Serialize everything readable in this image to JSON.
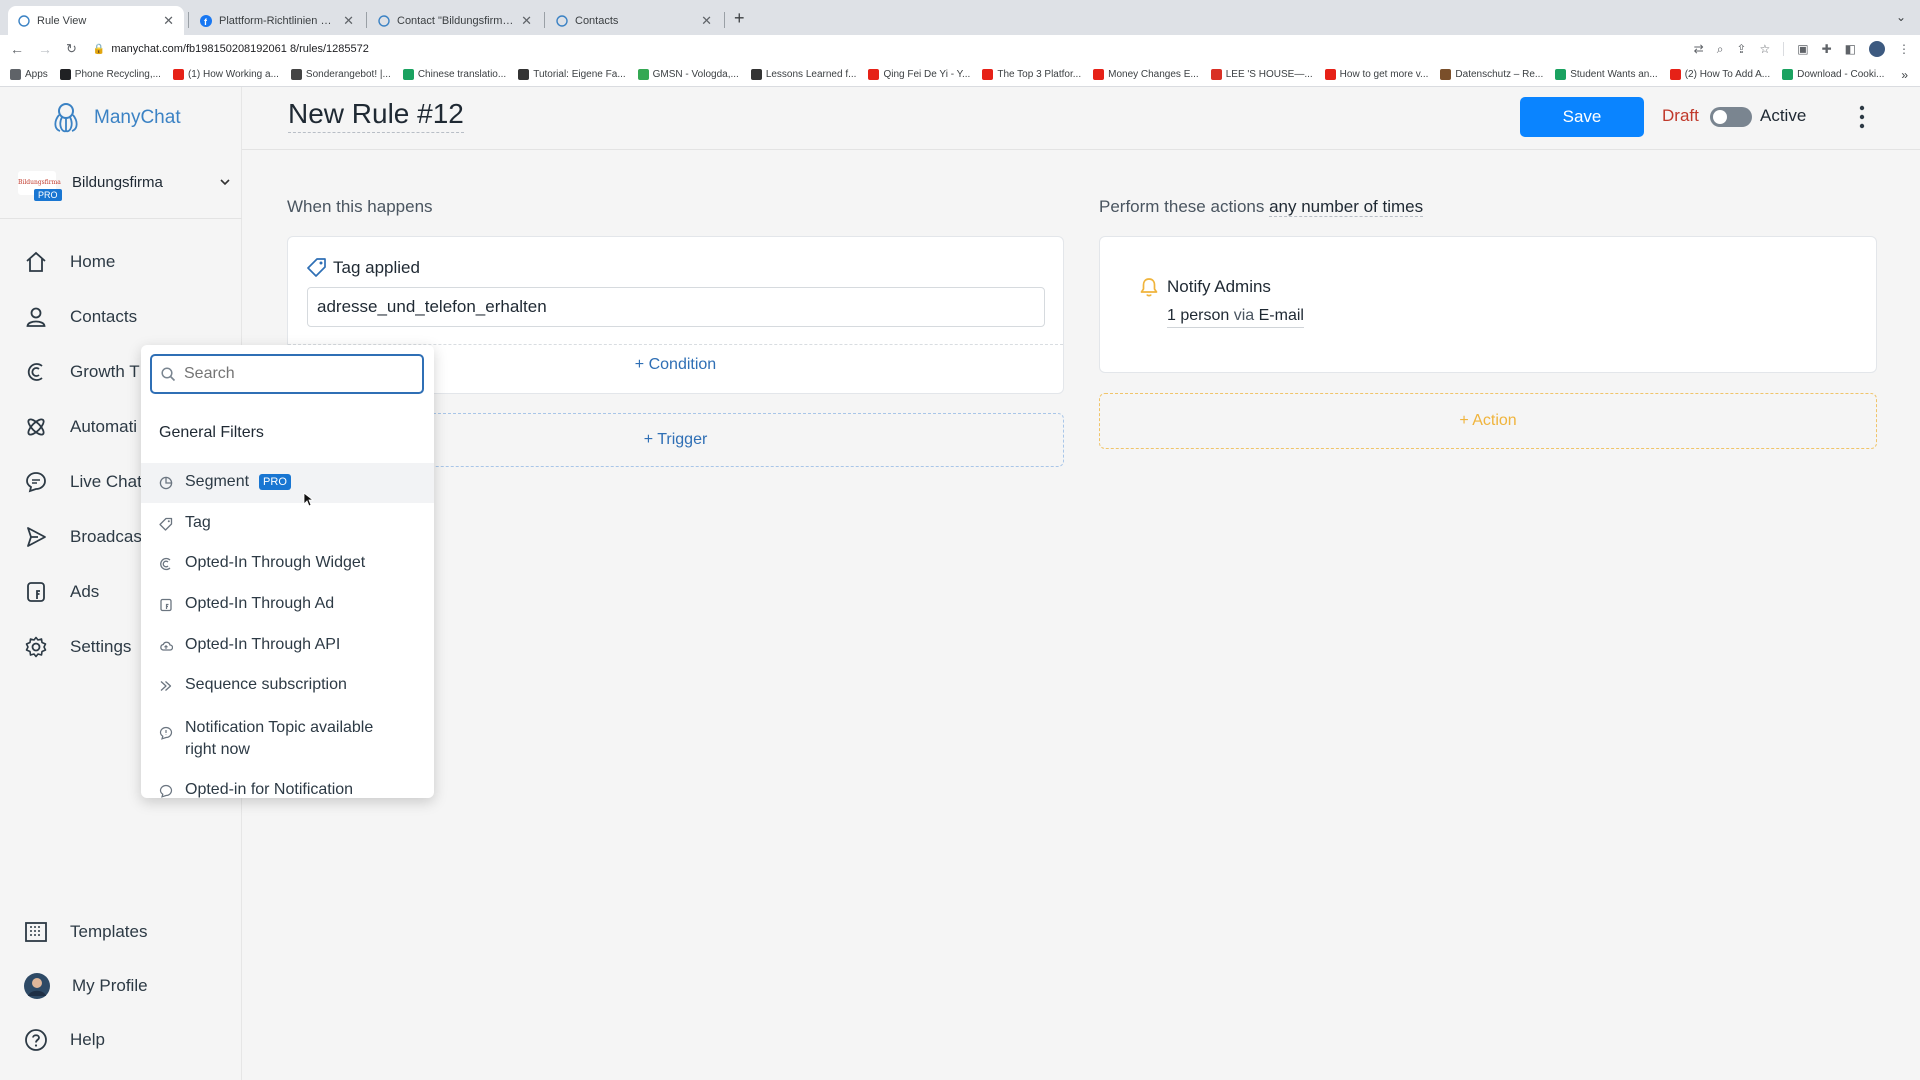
{
  "browser": {
    "tabs": [
      {
        "title": "Rule View",
        "active": true
      },
      {
        "title": "Plattform-Richtlinien – Übersi...",
        "active": false
      },
      {
        "title": "Contact \"Bildungsfirma\" throu...",
        "active": false
      },
      {
        "title": "Contacts",
        "active": false
      }
    ],
    "url": "manychat.com/fb198150208192061 8/rules/1285572",
    "bookmarks": [
      {
        "label": "Apps",
        "color": "#5f6368"
      },
      {
        "label": "Phone Recycling,...",
        "color": "#202124"
      },
      {
        "label": "(1) How Working a...",
        "color": "#e62117"
      },
      {
        "label": "Sonderangebot! |...",
        "color": "#444444"
      },
      {
        "label": "Chinese translatio...",
        "color": "#1aa260"
      },
      {
        "label": "Tutorial: Eigene Fa...",
        "color": "#333333"
      },
      {
        "label": "GMSN - Vologda,...",
        "color": "#34a853"
      },
      {
        "label": "Lessons Learned f...",
        "color": "#333333"
      },
      {
        "label": "Qing Fei De Yi - Y...",
        "color": "#e62117"
      },
      {
        "label": "The Top 3 Platfor...",
        "color": "#e62117"
      },
      {
        "label": "Money Changes E...",
        "color": "#e62117"
      },
      {
        "label": "LEE 'S HOUSE—...",
        "color": "#d93025"
      },
      {
        "label": "How to get more v...",
        "color": "#e62117"
      },
      {
        "label": "Datenschutz – Re...",
        "color": "#7a4f2a"
      },
      {
        "label": "Student Wants an...",
        "color": "#1aa260"
      },
      {
        "label": "(2) How To Add A...",
        "color": "#e62117"
      },
      {
        "label": "Download - Cooki...",
        "color": "#1aa260"
      }
    ]
  },
  "app": {
    "logo_text": "ManyChat",
    "account": {
      "name": "Bildungsfirma",
      "badge": "PRO"
    },
    "nav": [
      {
        "label": "Home",
        "icon": "home-icon"
      },
      {
        "label": "Contacts",
        "icon": "user-icon"
      },
      {
        "label": "Growth T",
        "icon": "growth-tools-icon"
      },
      {
        "label": "Automati",
        "icon": "automation-icon"
      },
      {
        "label": "Live Chat",
        "icon": "chat-icon"
      },
      {
        "label": "Broadcas",
        "icon": "broadcast-icon"
      },
      {
        "label": "Ads",
        "icon": "ads-icon"
      },
      {
        "label": "Settings",
        "icon": "gear-icon"
      }
    ],
    "nav_bottom": [
      {
        "label": "Templates",
        "icon": "templates-icon"
      },
      {
        "label": "My Profile",
        "icon": "avatar"
      },
      {
        "label": "Help",
        "icon": "help-icon"
      }
    ]
  },
  "header": {
    "title": "New Rule #12",
    "save_label": "Save",
    "draft_label": "Draft",
    "active_label": "Active"
  },
  "trigger": {
    "section_label": "When this happens",
    "card_title": "Tag applied",
    "tag_value": "adresse_und_telefon_erhalten",
    "condition_label": "+ Condition",
    "add_trigger_label": "+ Trigger"
  },
  "actions": {
    "section_label_prefix": "Perform these actions ",
    "section_label_emphasis": "any number of times",
    "card_title": "Notify Admins",
    "detail_count": "1 person",
    "detail_via": " via ",
    "detail_channel": "E-mail",
    "add_action_label": "+ Action"
  },
  "dropdown": {
    "search_placeholder": "Search",
    "group_label": "General Filters",
    "items": [
      {
        "label": "Segment",
        "badge": "PRO",
        "icon": "segment-icon"
      },
      {
        "label": "Tag",
        "icon": "tag-icon"
      },
      {
        "label": "Opted-In Through Widget",
        "icon": "widget-icon"
      },
      {
        "label": "Opted-In Through Ad",
        "icon": "ad-icon"
      },
      {
        "label": "Opted-In Through API",
        "icon": "cloud-icon"
      },
      {
        "label": "Sequence subscription",
        "icon": "sequence-icon"
      },
      {
        "label": "Notification Topic available right now",
        "icon": "notification-topic-icon"
      },
      {
        "label": "Opted-in for Notification",
        "icon": "notification-icon"
      }
    ]
  },
  "colors": {
    "primary": "#0a84ff",
    "draft": "#c0392b",
    "action_accent": "#f0b43c",
    "link": "#2f6fb5"
  }
}
